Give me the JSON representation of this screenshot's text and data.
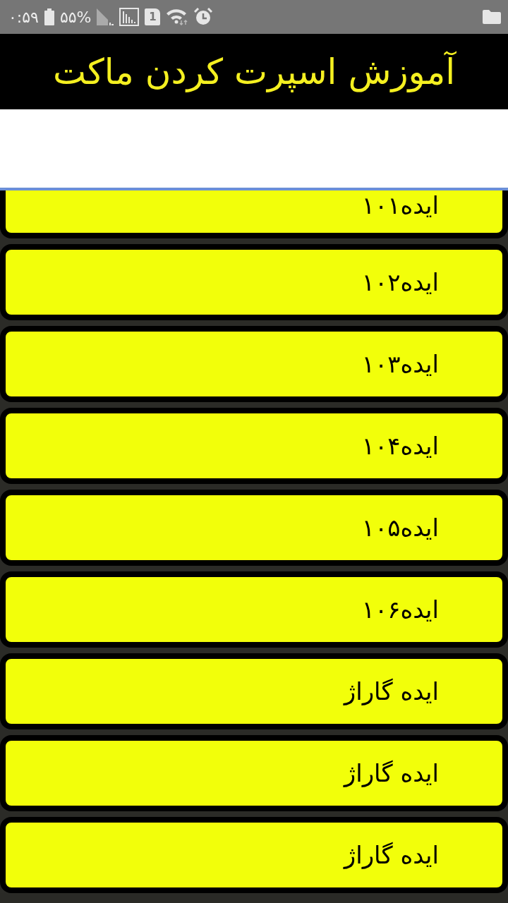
{
  "status_bar": {
    "time": "۰:۵۹",
    "battery": "۵۵%",
    "sim_slot": "1"
  },
  "app_bar": {
    "title": "آموزش اسپرت کردن ماکت"
  },
  "items": [
    {
      "label": "ایده۱۰۱",
      "partial": true
    },
    {
      "label": "ایده۱۰۲",
      "partial": false
    },
    {
      "label": "ایده۱۰۳",
      "partial": false
    },
    {
      "label": "ایده۱۰۴",
      "partial": false
    },
    {
      "label": "ایده۱۰۵",
      "partial": false
    },
    {
      "label": "ایده۱۰۶",
      "partial": false
    },
    {
      "label": "ایده گاراژ",
      "partial": false
    },
    {
      "label": "ایده گاراژ",
      "partial": false
    },
    {
      "label": "ایده گاراژ",
      "partial": false
    }
  ]
}
